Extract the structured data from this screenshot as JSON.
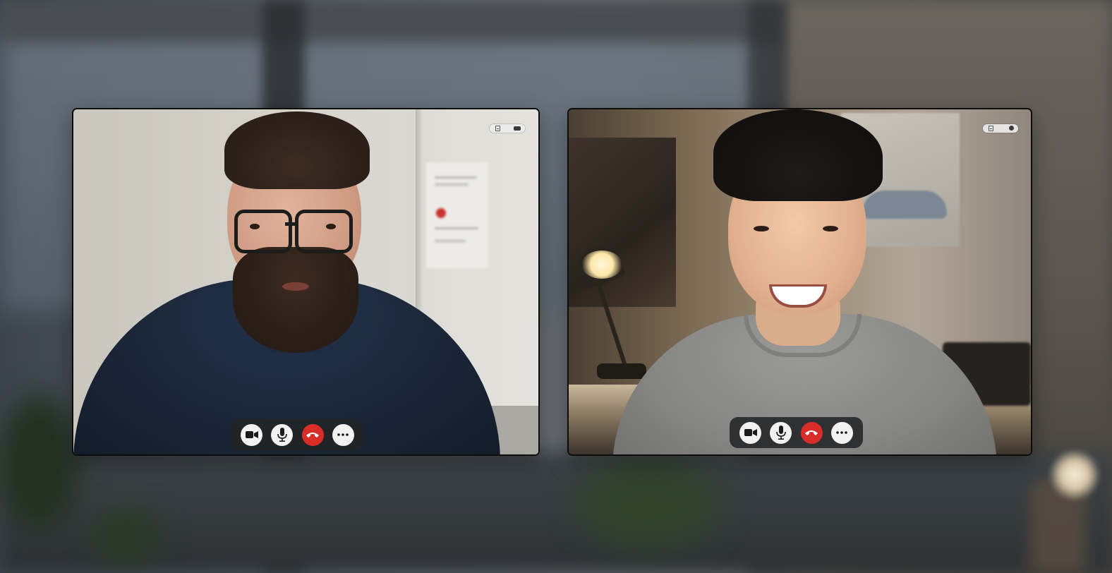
{
  "window": {
    "title": ""
  },
  "colors": {
    "control_bar": "#222426",
    "control_button": "#f2f2f2",
    "end_call": "#d92d2a",
    "icon": "#1a1a1a"
  },
  "participants": [
    {
      "id": "left",
      "status_icons": [
        "sidebar-icon",
        "battery-icon"
      ],
      "controls": [
        {
          "name": "video-camera-icon",
          "action": "toggle-video"
        },
        {
          "name": "microphone-icon",
          "action": "toggle-mic"
        },
        {
          "name": "end-call-icon",
          "action": "end-call"
        },
        {
          "name": "more-options-icon",
          "action": "more"
        }
      ]
    },
    {
      "id": "right",
      "status_icons": [
        "sidebar-icon",
        "record-icon"
      ],
      "controls": [
        {
          "name": "video-camera-icon",
          "action": "toggle-video"
        },
        {
          "name": "microphone-icon",
          "action": "toggle-mic"
        },
        {
          "name": "end-call-icon",
          "action": "end-call"
        },
        {
          "name": "more-options-icon",
          "action": "more"
        }
      ]
    }
  ]
}
